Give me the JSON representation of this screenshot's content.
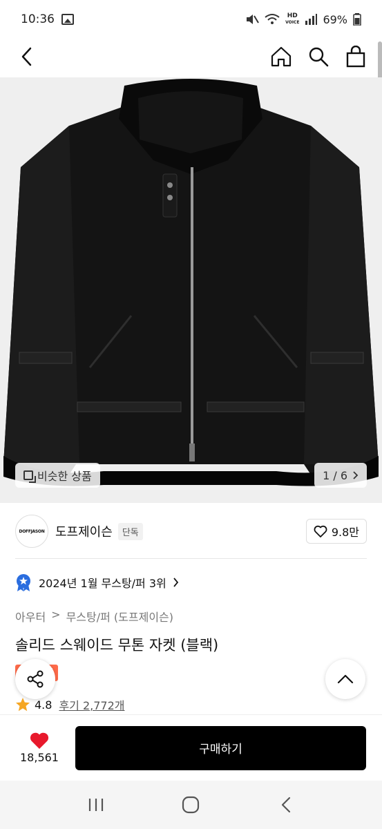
{
  "status_bar": {
    "time": "10:36",
    "network": "HD",
    "network_sub": "VOICE",
    "battery": "69%"
  },
  "header": {
    "back_icon": "chevron-left-icon",
    "actions": [
      "home-icon",
      "search-icon",
      "shopping-bag-icon"
    ]
  },
  "product_image": {
    "similar_label": "비슷한 상품",
    "counter": "1 / 6"
  },
  "brand": {
    "logo_text": "DOFFJASON",
    "name": "도프제이슨",
    "exclusive_badge": "단독",
    "likes": "9.8만"
  },
  "ranking": {
    "text": "2024년 1월 무스탕/퍼 3위"
  },
  "category": {
    "level1": "아우터",
    "separator": ">",
    "level2": "무스탕/퍼 (도프제이슨)"
  },
  "product": {
    "title": "솔리드 스웨이드 무톤 자켓 (블랙)",
    "sale_badge": "세일",
    "rating": "4.8",
    "reviews": "후기 2,772개"
  },
  "bottom_bar": {
    "wish_count": "18,561",
    "buy_label": "구매하기"
  },
  "colors": {
    "accent_red": "#e8192c",
    "sale_orange": "#ff6b4a",
    "star": "#f5a623",
    "rank_blue": "#2a6ddf"
  }
}
